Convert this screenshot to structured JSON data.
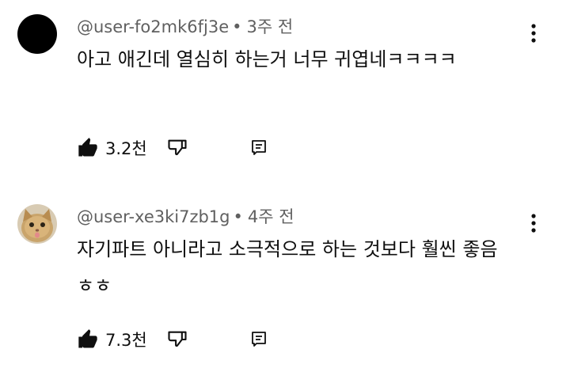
{
  "comments": [
    {
      "username": "@user-fo2mk6fj3e",
      "separator": "•",
      "time": "3주 전",
      "text": "아고 애긴데 열심히 하는거 너무 귀엽네ㅋㅋㅋㅋ",
      "likes": "3.2천",
      "avatar": "black-circle"
    },
    {
      "username": "@user-xe3ki7zb1g",
      "separator": "•",
      "time": "4주 전",
      "text": "자기파트 아니라고 소극적으로 하는 것보다 훨씬 좋음 ㅎㅎ",
      "likes": "7.3천",
      "avatar": "cat-photo"
    }
  ],
  "icons": {
    "like": "thumbs-up-filled-icon",
    "dislike": "thumbs-down-outline-icon",
    "reply": "reply-comment-icon",
    "more": "more-vertical-icon"
  },
  "colors": {
    "text": "#0f0f0f",
    "meta": "#606060",
    "background": "#ffffff"
  }
}
